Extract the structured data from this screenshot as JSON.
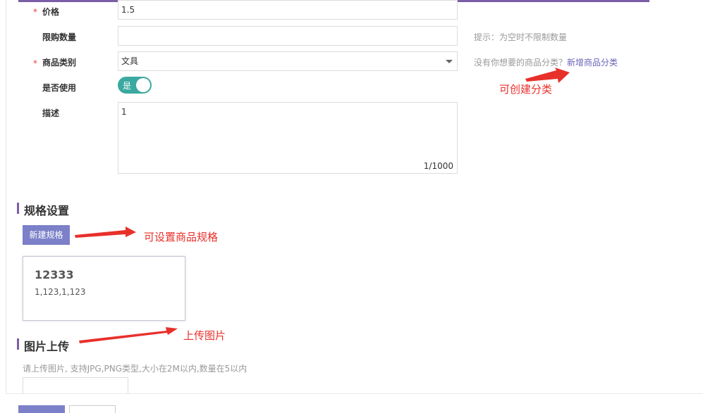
{
  "form": {
    "price": {
      "label": "价格",
      "required_mark": "*",
      "value": "1.5"
    },
    "limit": {
      "label": "限购数量",
      "value": "",
      "hint": "提示：为空时不限制数量"
    },
    "category": {
      "label": "商品类别",
      "required_mark": "*",
      "value": "文具",
      "hint_text": "没有你想要的商品分类？",
      "hint_link": "新增商品分类"
    },
    "enabled": {
      "label": "是否使用",
      "switch_text": "是",
      "on": true
    },
    "description": {
      "label": "描述",
      "value": "1",
      "counter": "1/1000"
    }
  },
  "spec_section": {
    "title": "规格设置",
    "new_button": "新建规格",
    "card": {
      "name": "12333",
      "values": "1,123,1,123"
    }
  },
  "image_section": {
    "title": "图片上传",
    "hint": "请上传图片, 支持JPG,PNG类型,大小在2M以内,数量在5以内"
  },
  "annotations": {
    "create_category": "可创建分类",
    "set_spec": "可设置商品规格",
    "upload_image": "上传图片"
  },
  "colors": {
    "accent": "#7b5ea7",
    "switch": "#3aa99f",
    "button": "#7b80c8",
    "annotation": "#e8302a"
  }
}
